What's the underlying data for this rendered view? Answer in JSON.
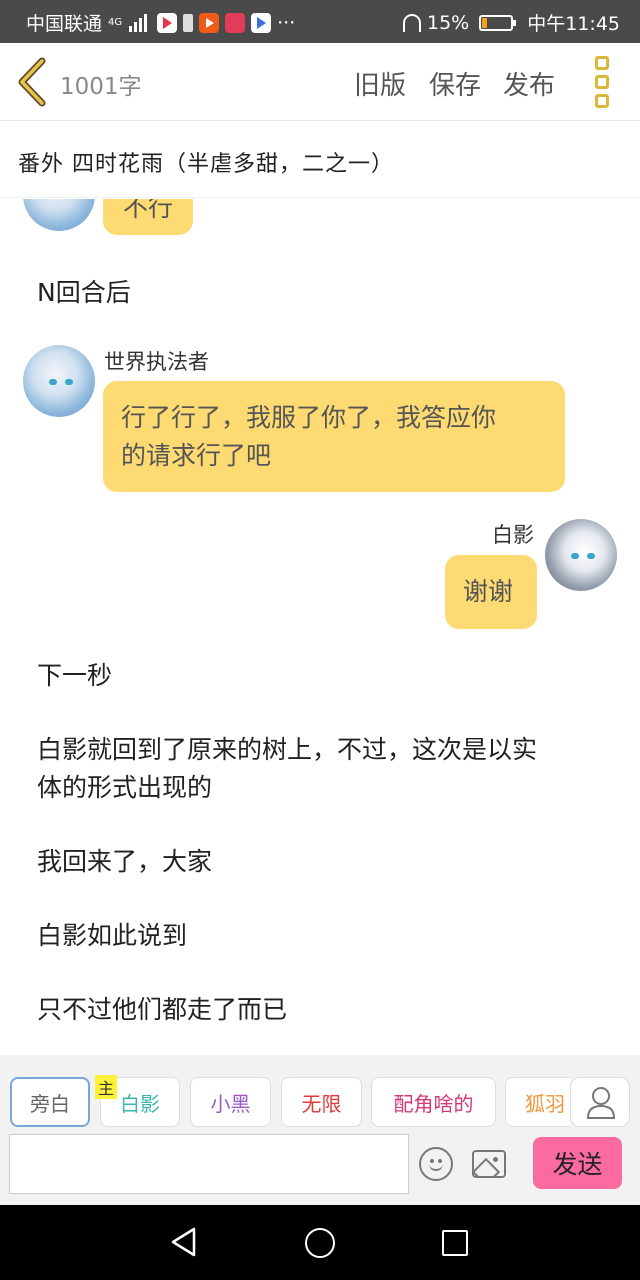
{
  "status_bar": {
    "carrier": "中国联通",
    "network": "4G",
    "more_dots": "···",
    "battery": "15%",
    "time": "中午11:45",
    "colors": {
      "battery_level": "#f7a21b"
    }
  },
  "header": {
    "word_count": "1001字",
    "old_version": "旧版",
    "save": "保存",
    "publish": "发布"
  },
  "chapter_title": "番外  四时花雨（半虐多甜，二之一）",
  "messages": [
    {
      "type": "bubble-left-partial",
      "text": "不行"
    },
    {
      "type": "narration",
      "text": "N回合后"
    },
    {
      "type": "bubble-left",
      "speaker": "世界执法者",
      "lines": [
        "行了行了，我服了你了，我答应你",
        "的请求行了吧"
      ]
    },
    {
      "type": "bubble-right",
      "speaker": "白影",
      "text": "谢谢"
    },
    {
      "type": "narration",
      "text": "下一秒"
    },
    {
      "type": "narration",
      "lines": [
        "白影就回到了原来的树上，不过，这次是以实",
        "体的形式出现的"
      ]
    },
    {
      "type": "narration",
      "text": "我回来了，大家"
    },
    {
      "type": "narration",
      "text": "白影如此说到"
    },
    {
      "type": "narration",
      "text": "只不过他们都走了而已"
    }
  ],
  "toolbar": {
    "main_badge": "主",
    "roles": [
      {
        "label": "旁白",
        "color": "#666666",
        "active": true
      },
      {
        "label": "白影",
        "color": "#3bb7b0"
      },
      {
        "label": "小黑",
        "color": "#9b59c9"
      },
      {
        "label": "无限",
        "color": "#e03b3b"
      },
      {
        "label": "配角啥的",
        "color": "#d6387a"
      },
      {
        "label": "狐羽",
        "color": "#f0963a"
      }
    ],
    "input_value": "",
    "send_label": "发送",
    "colors": {
      "send_bg": "#fb6ba0",
      "bubble": "#fdda72",
      "accent": "#d8b73a"
    }
  }
}
